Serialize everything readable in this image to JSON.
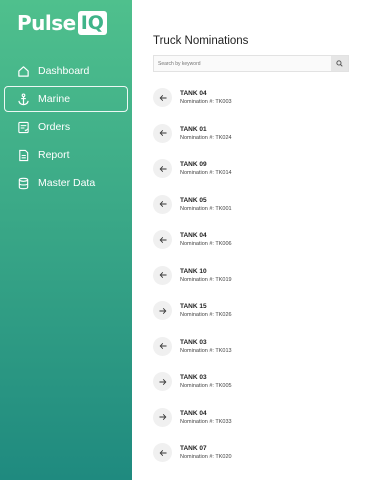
{
  "brand": {
    "name": "Pulse",
    "badge": "IQ"
  },
  "nav": [
    {
      "label": "Dashboard",
      "icon": "home-icon",
      "active": false
    },
    {
      "label": "Marine",
      "icon": "anchor-icon",
      "active": true
    },
    {
      "label": "Orders",
      "icon": "orders-icon",
      "active": false
    },
    {
      "label": "Report",
      "icon": "report-icon",
      "active": false
    },
    {
      "label": "Master Data",
      "icon": "database-icon",
      "active": false
    }
  ],
  "main": {
    "title": "Truck Nominations",
    "search_placeholder": "Search by keyword"
  },
  "nominations": [
    {
      "tank": "TANK 04",
      "nomination": "Nomination #: TK003",
      "direction": "left"
    },
    {
      "tank": "TANK 01",
      "nomination": "Nomination #: TK024",
      "direction": "left"
    },
    {
      "tank": "TANK 09",
      "nomination": "Nomination #: TK014",
      "direction": "left"
    },
    {
      "tank": "TANK 05",
      "nomination": "Nomination #: TK001",
      "direction": "left"
    },
    {
      "tank": "TANK 04",
      "nomination": "Nomination #: TK006",
      "direction": "left"
    },
    {
      "tank": "TANK 10",
      "nomination": "Nomination #: TK019",
      "direction": "left"
    },
    {
      "tank": "TANK 15",
      "nomination": "Nomination #: TK026",
      "direction": "right"
    },
    {
      "tank": "TANK 03",
      "nomination": "Nomination #: TK013",
      "direction": "left"
    },
    {
      "tank": "TANK 03",
      "nomination": "Nomination #: TK005",
      "direction": "right"
    },
    {
      "tank": "TANK 04",
      "nomination": "Nomination #: TK033",
      "direction": "right"
    },
    {
      "tank": "TANK 07",
      "nomination": "Nomination #: TK020",
      "direction": "left"
    }
  ]
}
